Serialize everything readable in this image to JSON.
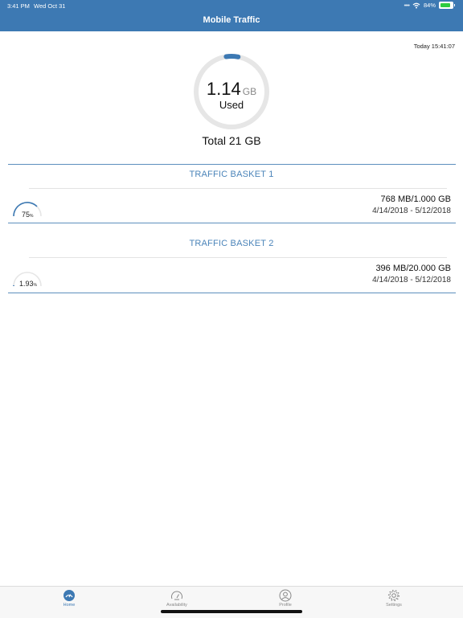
{
  "status_bar": {
    "time": "3:41 PM",
    "date": "Wed Oct 31",
    "battery": "84%",
    "battery_level": 0.84
  },
  "header": {
    "title": "Mobile Traffic"
  },
  "updated": "Today 15:41:07",
  "summary": {
    "used_value": "1.14",
    "used_unit": "GB",
    "used_label": "Used",
    "total": "Total 21 GB",
    "used_fraction": 0.054
  },
  "baskets": [
    {
      "title": "TRAFFIC BASKET 1",
      "percent": "75",
      "percent_unit": "%",
      "fraction": 0.75,
      "usage": "768 MB/1.000 GB",
      "dates": "4/14/2018 - 5/12/2018"
    },
    {
      "title": "TRAFFIC BASKET 2",
      "percent": "1.93",
      "percent_unit": "%",
      "fraction": 0.0193,
      "usage": "396 MB/20.000 GB",
      "dates": "4/14/2018 - 5/12/2018"
    }
  ],
  "tabs": [
    {
      "label": "Home",
      "icon": "home-gauge-icon",
      "active": true
    },
    {
      "label": "Availability",
      "icon": "speedometer-icon",
      "active": false
    },
    {
      "label": "Profile",
      "icon": "person-icon",
      "active": false
    },
    {
      "label": "Settings",
      "icon": "gear-icon",
      "active": false
    }
  ],
  "colors": {
    "accent": "#3d79b3",
    "track": "#e6e6e6"
  }
}
